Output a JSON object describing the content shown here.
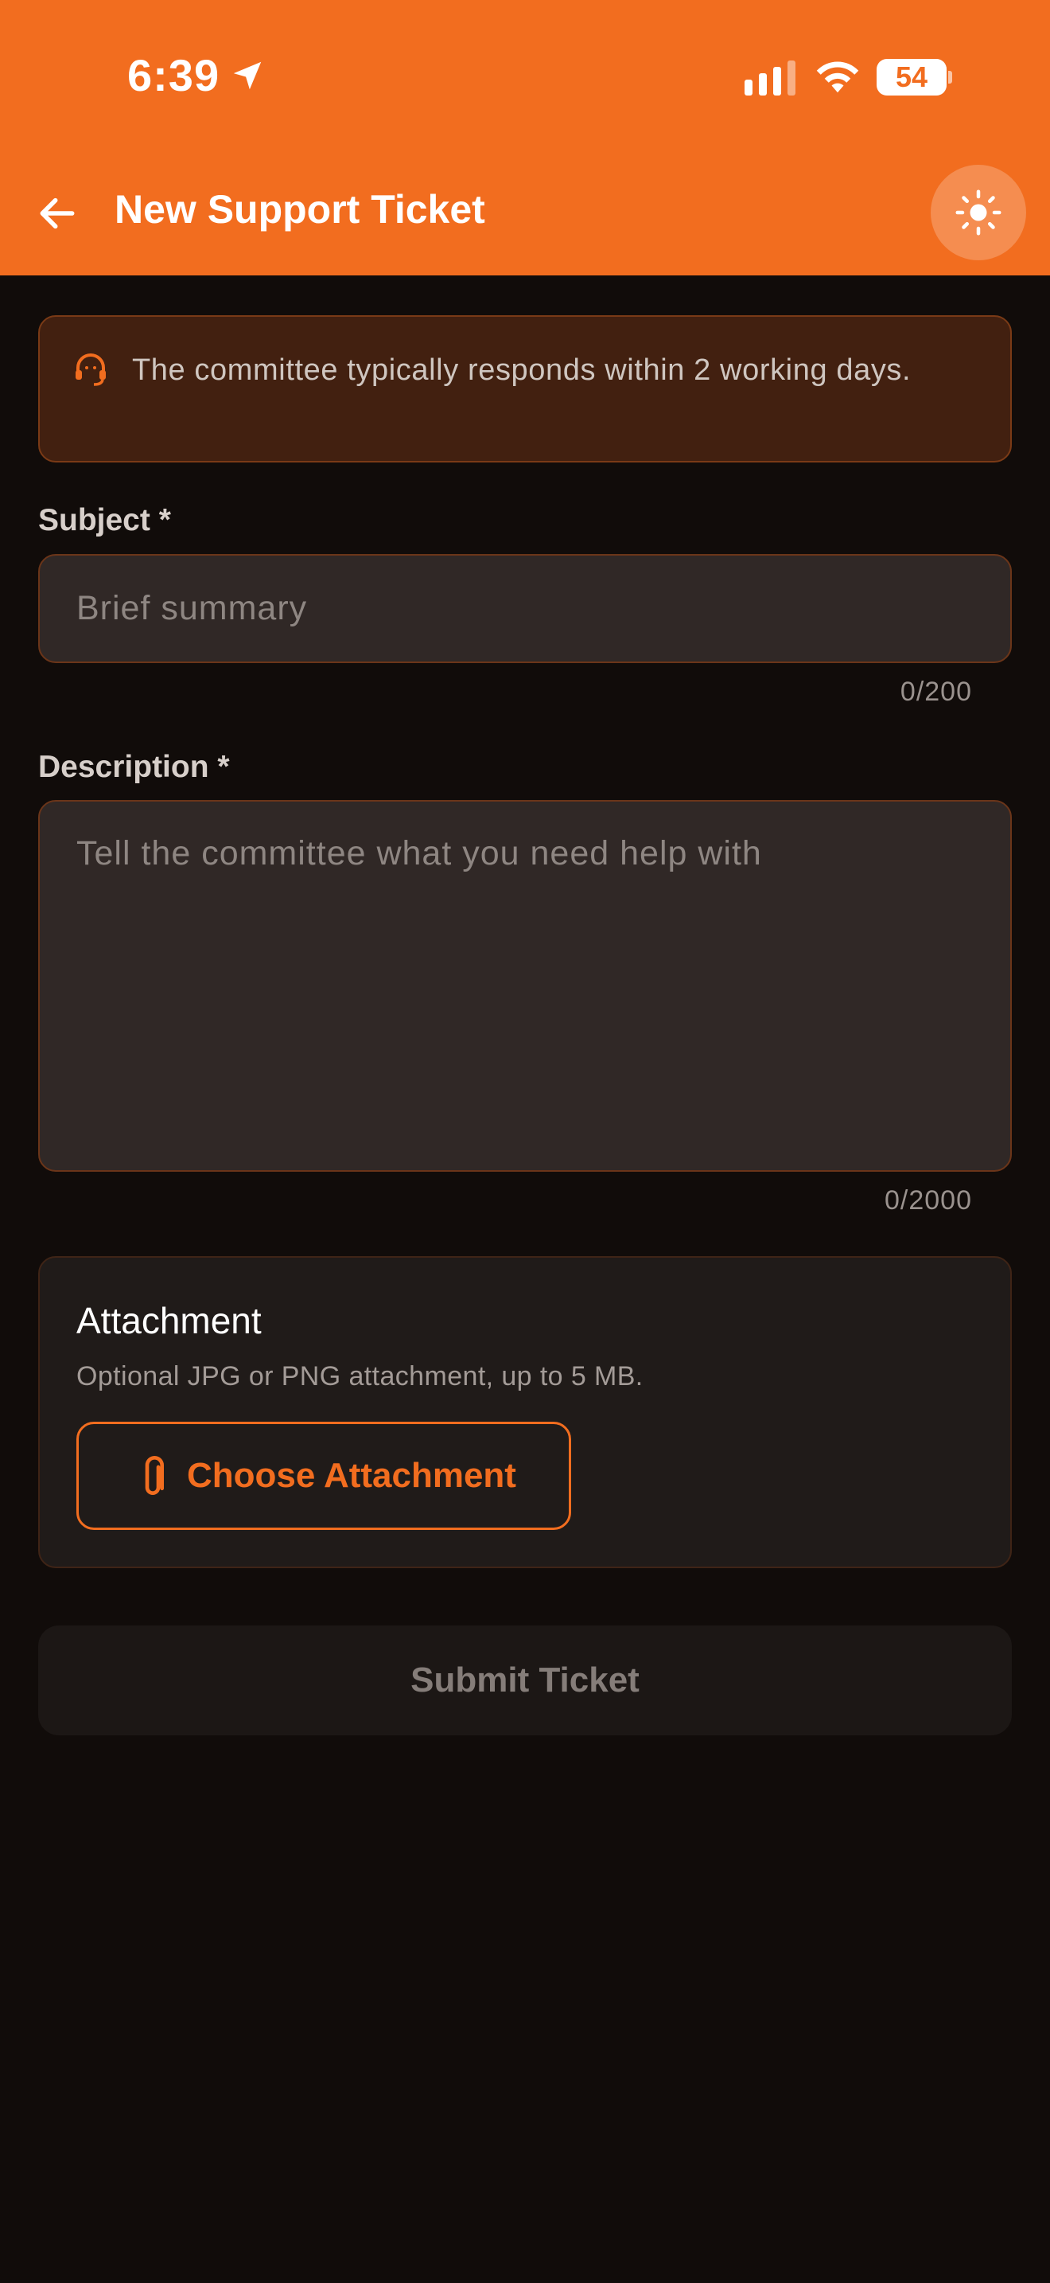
{
  "status_bar": {
    "time": "6:39",
    "battery": "54",
    "icons": [
      "location-arrow-icon",
      "cellular-signal-icon",
      "wifi-icon",
      "battery-icon"
    ]
  },
  "header": {
    "title": "New Support Ticket",
    "background_color": "#f26d1f",
    "back_icon": "arrow-left-icon",
    "theme_icon": "sun-icon"
  },
  "info_banner": {
    "icon": "headset-icon",
    "text": "The committee typically responds within 2 working days."
  },
  "form": {
    "subject": {
      "label": "Subject *",
      "placeholder": "Brief summary",
      "value": "",
      "counter": "0/200"
    },
    "description": {
      "label": "Description *",
      "placeholder": "Tell the committee what you need help with",
      "value": "",
      "counter": "0/2000"
    }
  },
  "attachment": {
    "title": "Attachment",
    "subtitle": "Optional JPG or PNG attachment, up to 5 MB.",
    "button_label": "Choose Attachment",
    "button_icon": "paperclip-icon"
  },
  "submit": {
    "label": "Submit Ticket",
    "enabled": false
  },
  "colors": {
    "accent": "#f26d1f",
    "background": "#110c0a",
    "field_bg": "#302826",
    "banner_bg": "#422010"
  }
}
